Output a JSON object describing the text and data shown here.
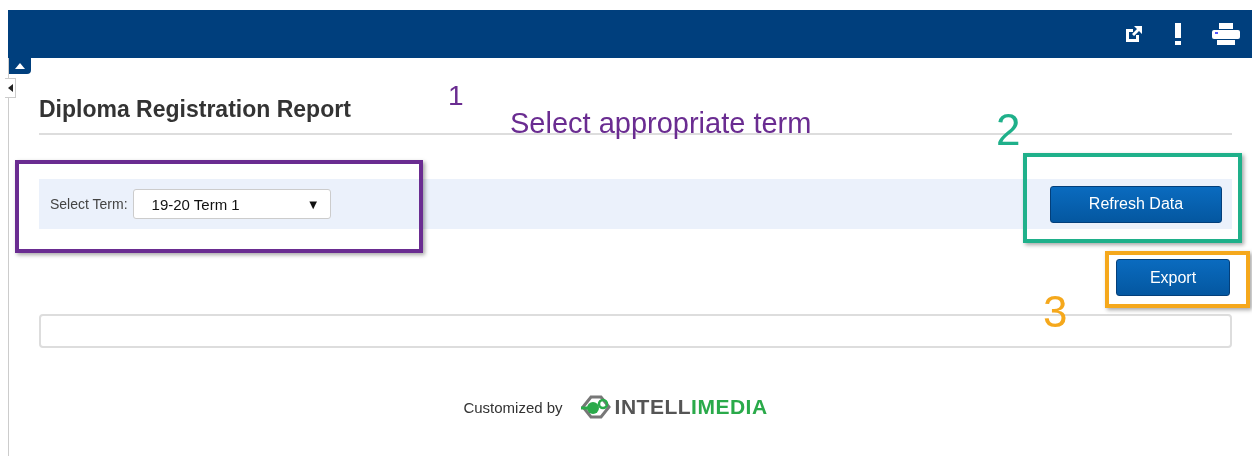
{
  "toolbar": {
    "icons": [
      {
        "kind": "share"
      },
      {
        "kind": "alert"
      },
      {
        "kind": "print"
      }
    ]
  },
  "report": {
    "title": "Diploma Registration Report"
  },
  "filter": {
    "label": "Select Term:",
    "term": "19-20 Term 1",
    "caret": "▼",
    "refresh_button": "Refresh Data"
  },
  "export_button": "Export",
  "footer": {
    "text": "Customized by",
    "logo_gray": "INTELL",
    "logo_green": "IMEDIA"
  },
  "annotations": [
    {
      "kind": "box",
      "color": "#6a2c91"
    },
    {
      "kind": "box",
      "color": "#1fb08a"
    },
    {
      "kind": "box",
      "color": "#f5a81c"
    },
    {
      "kind": "label",
      "text": "1",
      "color": "#6a2c91"
    },
    {
      "kind": "label",
      "text": "Select appropriate term",
      "color": "#6a2c91"
    },
    {
      "kind": "label",
      "text": "2",
      "color": "#1fb08a"
    },
    {
      "kind": "label",
      "text": "3",
      "color": "#f5a81c"
    }
  ]
}
